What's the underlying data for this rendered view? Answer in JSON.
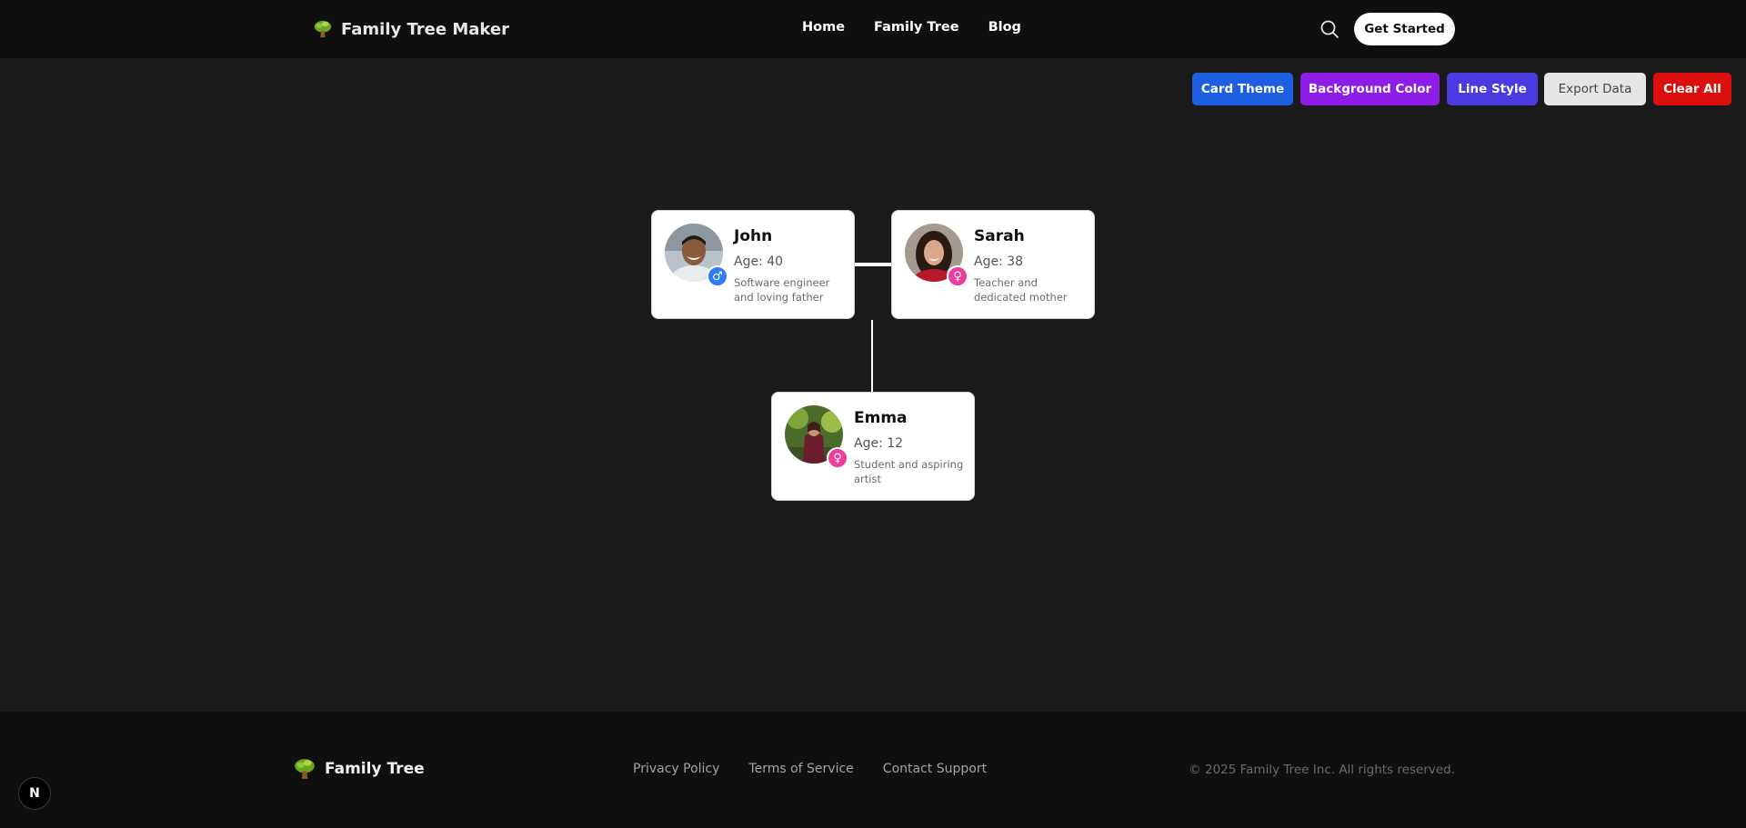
{
  "header": {
    "brand": "Family Tree Maker",
    "nav": [
      "Home",
      "Family Tree",
      "Blog"
    ],
    "get_started": "Get Started"
  },
  "toolbar": {
    "card_theme": "Card Theme",
    "background_color": "Background Color",
    "line_style": "Line Style",
    "export_data": "Export Data",
    "clear_all": "Clear All"
  },
  "colors": {
    "card_theme": "#1d5fe0",
    "background_color": "#8e1de6",
    "line_style": "#4b3ae0",
    "export_data": "#e5e5e5",
    "clear_all": "#dc0f0f",
    "male_badge": "#2f7bf5",
    "female_badge": "#ec3d9b",
    "canvas_bg": "#1a1a1a"
  },
  "members": [
    {
      "name": "John",
      "age": "Age: 40",
      "bio": "Software engineer and loving father",
      "gender_icon": "♂"
    },
    {
      "name": "Sarah",
      "age": "Age: 38",
      "bio": "Teacher and dedicated mother",
      "gender_icon": "♀"
    },
    {
      "name": "Emma",
      "age": "Age: 12",
      "bio": "Student and aspiring artist",
      "gender_icon": "♀"
    }
  ],
  "footer": {
    "brand": "Family Tree",
    "links": [
      "Privacy Policy",
      "Terms of Service",
      "Contact Support"
    ],
    "copyright": "© 2025 Family Tree Inc. All rights reserved."
  },
  "badge": "N"
}
